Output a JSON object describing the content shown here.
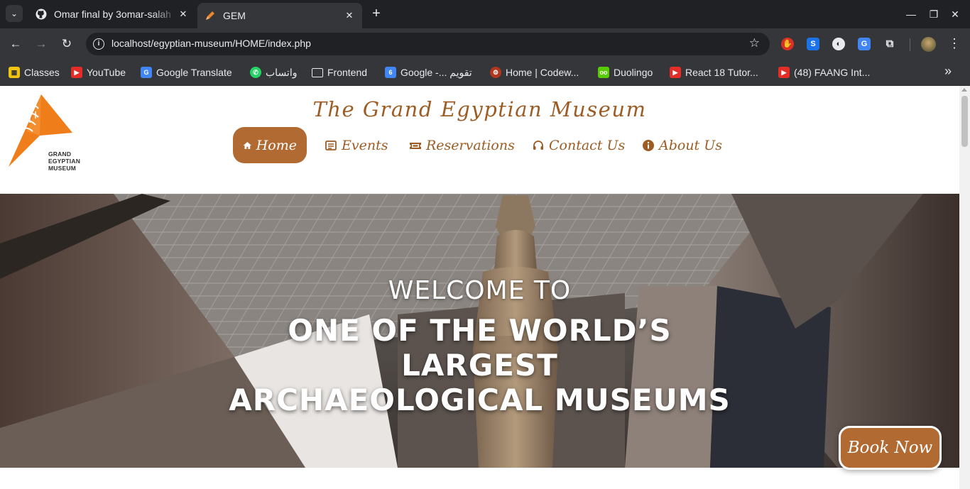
{
  "browser": {
    "tabs": [
      {
        "title": "Omar final by 3omar-salah",
        "close": "✕",
        "icon": "github-icon",
        "active": false
      },
      {
        "title": "GEM",
        "close": "✕",
        "icon": "pen-favicon",
        "active": true
      }
    ],
    "new_tab": "+",
    "url": "localhost/egyptian-museum/HOME/index.php",
    "bookmarks": [
      {
        "label": "Classes",
        "icon": "classes-icon",
        "color": "#f1c40f"
      },
      {
        "label": "YouTube",
        "icon": "youtube-icon",
        "color": "#e52d27"
      },
      {
        "label": "Google Translate",
        "icon": "translate-icon",
        "color": "#4285f4"
      },
      {
        "label": "واتساب",
        "icon": "whatsapp-icon",
        "color": "#25d366"
      },
      {
        "label": "Frontend",
        "icon": "folder-icon",
        "color": "#e8eaed"
      },
      {
        "label": "Google -... تقويم",
        "icon": "calendar-icon",
        "color": "#4285f4"
      },
      {
        "label": "Home | Codew...",
        "icon": "codewars-icon",
        "color": "#b1361e"
      },
      {
        "label": "Duolingo",
        "icon": "duolingo-icon",
        "color": "#58cc02"
      },
      {
        "label": "React 18 Tutor...",
        "icon": "youtube-icon",
        "color": "#e52d27"
      },
      {
        "label": "(48) FAANG Int...",
        "icon": "youtube-icon",
        "color": "#e52d27"
      }
    ],
    "bookmarks_more": "»"
  },
  "site": {
    "title": "The Grand Egyptian Museum",
    "logo_lines": [
      "GRAND",
      "EGYPTIAN",
      "MUSEUM"
    ],
    "brand_color": "#b06a32",
    "nav": [
      {
        "label": "Home",
        "icon": "home-icon",
        "active": true
      },
      {
        "label": "Events",
        "icon": "newspaper-icon",
        "active": false
      },
      {
        "label": "Reservations",
        "icon": "ticket-icon",
        "active": false
      },
      {
        "label": "Contact Us",
        "icon": "headset-icon",
        "active": false
      },
      {
        "label": "About Us",
        "icon": "info-icon",
        "active": false
      }
    ]
  },
  "hero": {
    "welcome": "WELCOME TO",
    "headline_line1": "ONE OF THE WORLD’S LARGEST",
    "headline_line2": "ARCHAEOLOGICAL MUSEUMS",
    "cta": "Book Now"
  }
}
